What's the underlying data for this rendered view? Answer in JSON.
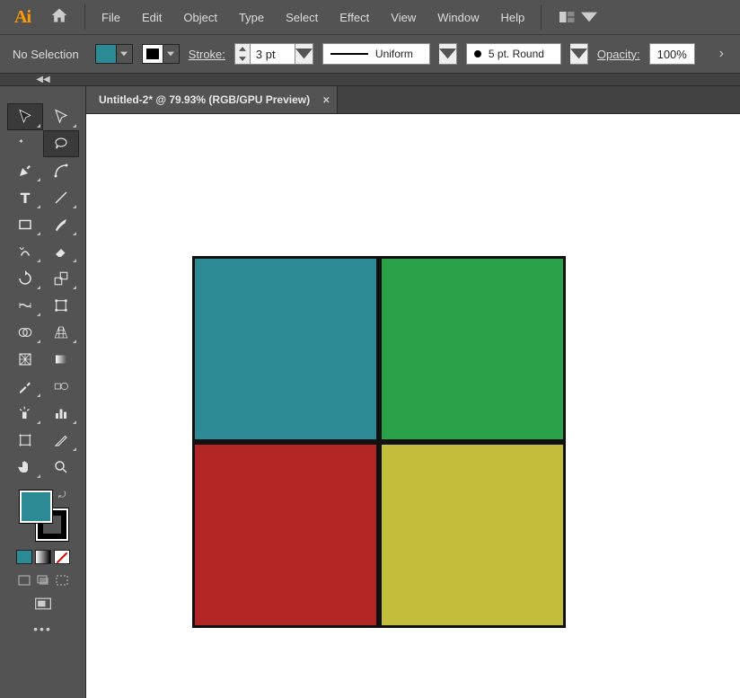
{
  "menu": {
    "items": [
      "File",
      "Edit",
      "Object",
      "Type",
      "Select",
      "Effect",
      "View",
      "Window",
      "Help"
    ]
  },
  "controlbar": {
    "selection_label": "No Selection",
    "fill_color": "#2b8a93",
    "stroke_color": "#000000",
    "stroke_label": "Stroke:",
    "stroke_value": "3 pt",
    "profile_label": "Uniform",
    "brush_label": "5 pt. Round",
    "opacity_label": "Opacity:",
    "opacity_value": "100%"
  },
  "tab": {
    "title": "Untitled-2* @ 79.93% (RGB/GPU Preview)"
  },
  "artwork": {
    "stroke_width": "3",
    "stroke_color": "#111111",
    "squares": [
      {
        "id": "top-left",
        "fill": "#2b8a93"
      },
      {
        "id": "top-right",
        "fill": "#2aa24a"
      },
      {
        "id": "bottom-left",
        "fill": "#b32626"
      },
      {
        "id": "bottom-right",
        "fill": "#c2bd3a"
      }
    ]
  },
  "toolbox": {
    "fill_color": "#2b8a93",
    "stroke_color": "#000000"
  }
}
